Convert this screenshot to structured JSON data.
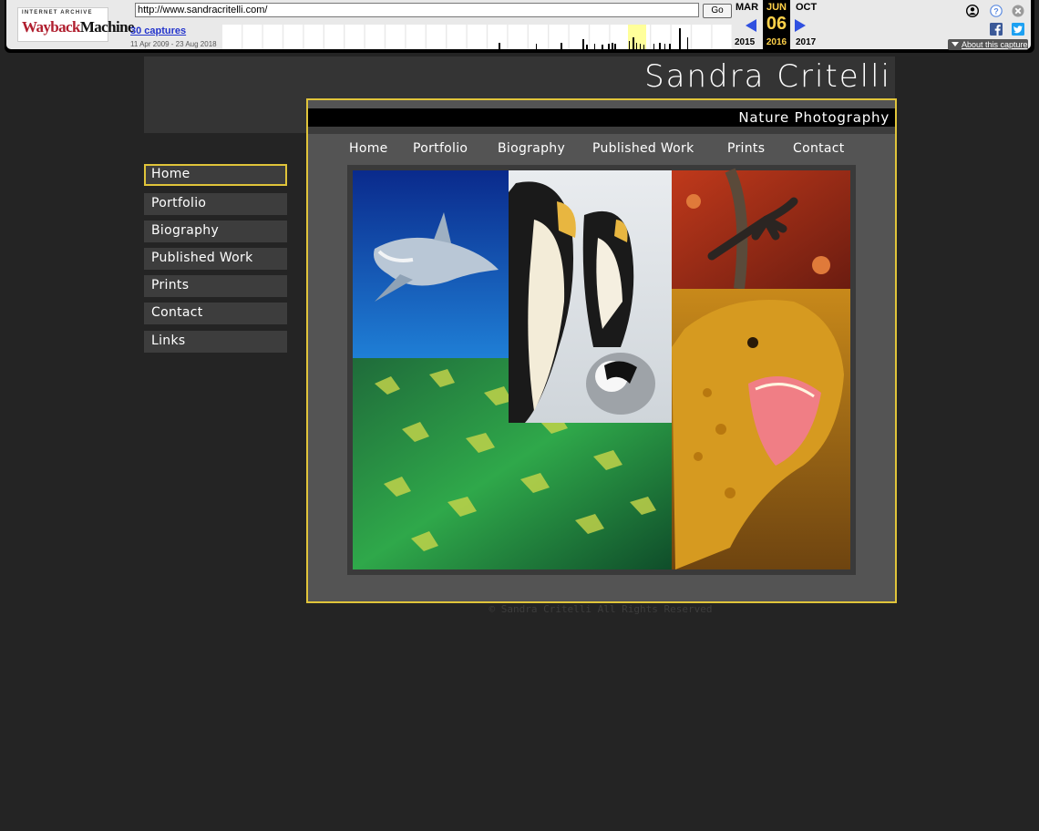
{
  "wayback": {
    "logo_top": "INTERNET ARCHIVE",
    "logo_way": "Wayback",
    "logo_machine": "Machine",
    "url": "http://www.sandracritelli.com/",
    "go_label": "Go",
    "captures_label": "30 captures",
    "date_range": "11 Apr 2009 - 23 Aug 2018",
    "prev_month": "MAR",
    "current_month": "JUN",
    "next_month": "OCT",
    "current_day": "06",
    "prev_year": "2015",
    "current_year": "2016",
    "next_year": "2017",
    "about_label": "About this capture",
    "accent_color": "#ffd24a"
  },
  "site": {
    "title": "Sandra Critelli",
    "subtitle": "Nature Photography",
    "top_nav": [
      "Home",
      "Portfolio",
      "Biography",
      "Published Work",
      "Prints",
      "Contact"
    ],
    "side_nav": [
      "Home",
      "Portfolio",
      "Biography",
      "Published Work",
      "Prints",
      "Contact",
      "Links"
    ],
    "active_item": "Home",
    "copyright": "© Sandra Critelli All Rights Reserved",
    "accent_color": "#e0c43a",
    "collage": [
      "shark",
      "emperor-penguins",
      "frog-hand",
      "iguana",
      "golden-rays"
    ]
  }
}
